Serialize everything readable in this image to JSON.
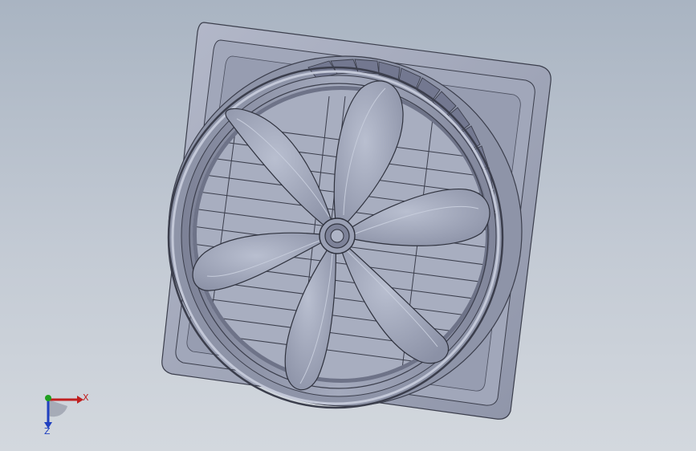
{
  "window": {
    "background_top": "#a9b4c2",
    "background_bottom": "#d3d8de"
  },
  "model": {
    "icon": "exhaust-fan-3d-model",
    "body_color": "#9ea4b8",
    "shadow_color": "#6f7489",
    "edge_color": "#3b3e4c",
    "highlight_color": "#c3c8d8",
    "blade_count": 5
  },
  "triad": {
    "icon": "coordinate-triad-icon",
    "x_label": "X",
    "z_label": "Z",
    "x_color": "#c02020",
    "y_color": "#20a020",
    "z_color": "#2040c0"
  }
}
